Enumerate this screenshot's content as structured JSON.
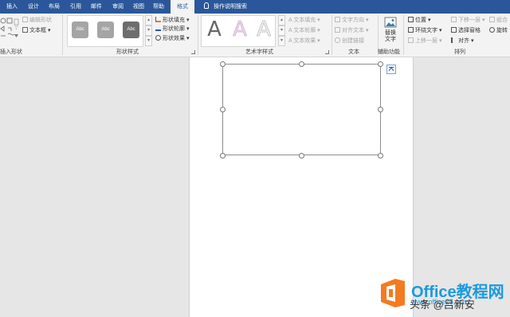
{
  "tabs": [
    {
      "label": "插入",
      "active": false
    },
    {
      "label": "设计",
      "active": false
    },
    {
      "label": "布局",
      "active": false
    },
    {
      "label": "引用",
      "active": false
    },
    {
      "label": "邮件",
      "active": false
    },
    {
      "label": "审阅",
      "active": false
    },
    {
      "label": "视图",
      "active": false
    },
    {
      "label": "帮助",
      "active": false
    },
    {
      "label": "格式",
      "active": true
    }
  ],
  "tell_me": "操作说明搜索",
  "groups": {
    "insert_shapes": {
      "label": "插入形状",
      "edit_shape": "编辑形状",
      "text_box": "文本框"
    },
    "shape_styles": {
      "label": "形状样式",
      "thumb_text": "Abc",
      "fill": "形状填充",
      "outline": "形状轮廓",
      "effects": "形状效果"
    },
    "wordart": {
      "label": "艺术字样式",
      "glyph": "A",
      "text_fill": "文本填充",
      "text_outline": "文本轮廓",
      "text_effects": "文本效果"
    },
    "text": {
      "label": "文本",
      "direction": "文字方向",
      "align": "对齐文本",
      "link": "创建链接"
    },
    "accessibility": {
      "label": "辅助功能",
      "alt_text_1": "替换",
      "alt_text_2": "文字"
    },
    "arrange": {
      "label": "排列",
      "position": "位置",
      "wrap": "环绕文字",
      "forward": "上移一层",
      "backward": "下移一层",
      "selection_pane": "选择窗格",
      "align": "对齐",
      "group": "组合",
      "rotate": "旋转"
    }
  },
  "watermark": {
    "brand": "Office教程网",
    "url": "www.office26.com",
    "caption": "头条 @吕新安"
  },
  "colors": {
    "tab_bar": "#2b579a",
    "ribbon": "#f3f3f3",
    "canvas": "#e6e6e6",
    "watermark_orange": "#f37b21",
    "watermark_blue": "#1a9ae0"
  }
}
